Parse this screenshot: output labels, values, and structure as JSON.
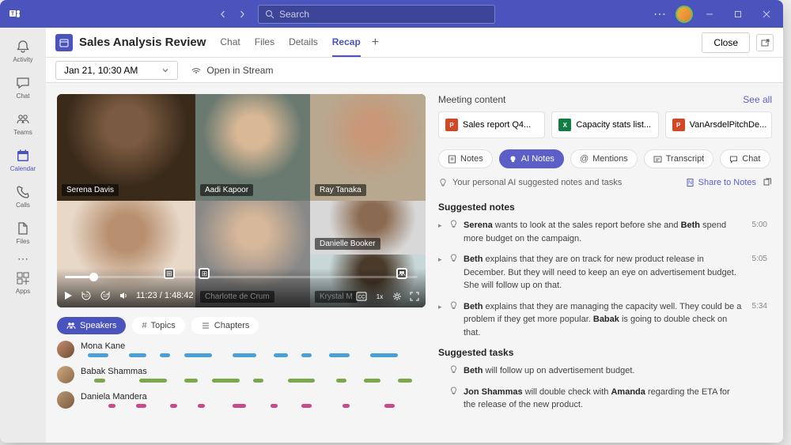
{
  "titlebar": {
    "search_placeholder": "Search"
  },
  "rail": {
    "items": [
      {
        "label": "Activity",
        "icon": "bell"
      },
      {
        "label": "Chat",
        "icon": "chat"
      },
      {
        "label": "Teams",
        "icon": "teams"
      },
      {
        "label": "Calendar",
        "icon": "calendar"
      },
      {
        "label": "Calls",
        "icon": "calls"
      },
      {
        "label": "Files",
        "icon": "files"
      }
    ],
    "active_index": 3,
    "apps_label": "Apps"
  },
  "header": {
    "title": "Sales Analysis Review",
    "tabs": [
      "Chat",
      "Files",
      "Details",
      "Recap"
    ],
    "active_tab_index": 3,
    "close_label": "Close"
  },
  "subheader": {
    "date_label": "Jan 21, 10:30 AM",
    "stream_label": "Open in Stream"
  },
  "video": {
    "participants": [
      {
        "name": "Serena Davis"
      },
      {
        "name": "Aadi Kapoor"
      },
      {
        "name": "Ray Tanaka"
      },
      {
        "name": ""
      },
      {
        "name": "Charlotte de Crum"
      },
      {
        "name": "Danielle Booker"
      },
      {
        "name": "Krystal M"
      }
    ],
    "time_current": "11:23",
    "time_total": "1:48:42"
  },
  "chips": {
    "speakers": "Speakers",
    "topics": "Topics",
    "chapters": "Chapters"
  },
  "speakers": [
    {
      "name": "Mona Kane",
      "color": "#4aa0d8",
      "segs": [
        [
          2,
          6
        ],
        [
          14,
          5
        ],
        [
          23,
          3
        ],
        [
          30,
          8
        ],
        [
          44,
          7
        ],
        [
          56,
          4
        ],
        [
          64,
          3
        ],
        [
          72,
          6
        ],
        [
          84,
          8
        ]
      ]
    },
    {
      "name": "Babak Shammas",
      "color": "#7aa84a",
      "segs": [
        [
          4,
          3
        ],
        [
          17,
          8
        ],
        [
          30,
          4
        ],
        [
          38,
          8
        ],
        [
          50,
          3
        ],
        [
          60,
          8
        ],
        [
          74,
          3
        ],
        [
          82,
          5
        ],
        [
          92,
          4
        ]
      ]
    },
    {
      "name": "Daniela Mandera",
      "color": "#c94a8c",
      "segs": [
        [
          8,
          2
        ],
        [
          16,
          3
        ],
        [
          26,
          2
        ],
        [
          34,
          2
        ],
        [
          44,
          4
        ],
        [
          55,
          2
        ],
        [
          64,
          3
        ],
        [
          76,
          2
        ],
        [
          88,
          3
        ]
      ]
    }
  ],
  "meeting_content": {
    "title": "Meeting content",
    "see_all": "See all",
    "files": [
      {
        "type": "ppt",
        "label": "Sales report Q4..."
      },
      {
        "type": "xls",
        "label": "Capacity stats list..."
      },
      {
        "type": "ppt",
        "label": "VanArsdelPitchDe..."
      }
    ]
  },
  "pills": {
    "notes": "Notes",
    "ai": "AI Notes",
    "mentions": "Mentions",
    "transcript": "Transcript",
    "chat": "Chat"
  },
  "ai_sub": {
    "text": "Your personal AI suggested notes and tasks",
    "share": "Share to Notes"
  },
  "notes": {
    "suggested_title": "Suggested notes",
    "tasks_title": "Suggested tasks",
    "items": [
      {
        "time": "5:00",
        "html": "<b>Serena</b> wants to look at the sales report before she and <b>Beth</b> spend more budget on the campaign."
      },
      {
        "time": "5:05",
        "html": "<b>Beth</b> explains that they are on track for new product release in December. But they will need to keep an eye on advertisement budget. She will follow up on that."
      },
      {
        "time": "5:34",
        "html": "<b>Beth</b> explains that they are managing the capacity well. They could be a problem if they get more popular. <b>Babak</b> is going to double check on that."
      }
    ],
    "tasks": [
      {
        "html": "<b>Beth</b> will follow up on advertisement budget."
      },
      {
        "html": "<b>Jon Shammas</b> will double check with <b>Amanda</b> regarding the ETA for the release of the new product."
      }
    ]
  }
}
